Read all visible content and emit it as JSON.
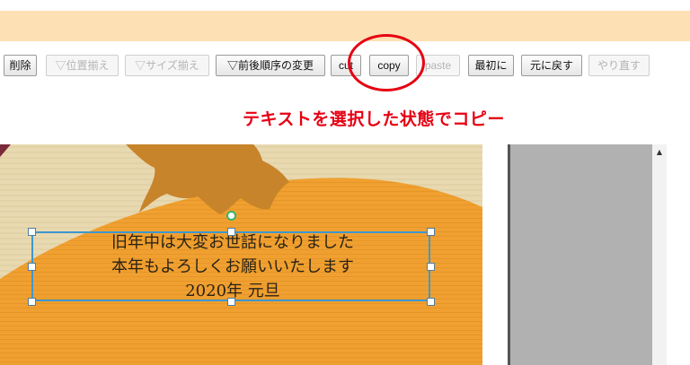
{
  "toolbar": {
    "buttons": [
      {
        "label": "削除",
        "enabled": true
      },
      {
        "label": "▽位置揃え",
        "enabled": false
      },
      {
        "label": "▽サイズ揃え",
        "enabled": false
      },
      {
        "label": "▽前後順序の変更",
        "enabled": true
      },
      {
        "label": "cut",
        "enabled": true
      },
      {
        "label": "copy",
        "enabled": true
      },
      {
        "label": "paste",
        "enabled": false
      },
      {
        "label": "最初に",
        "enabled": true
      },
      {
        "label": "元に戻す",
        "enabled": true
      },
      {
        "label": "やり直す",
        "enabled": false
      }
    ]
  },
  "annotation": {
    "text": "テキストを選択した状態でコピー",
    "color": "#e60012"
  },
  "card": {
    "lines": [
      "旧年中は大変お世話になりました",
      "本年もよろしくお願いいたします",
      "2020年 元旦"
    ]
  },
  "colors": {
    "topbar": "#fde0b3",
    "card_orange": "#f0a030",
    "card_beige": "#e8d9b0",
    "card_brown": "#c8842a",
    "selection": "#3f97cf",
    "side_panel": "#b1b1b1"
  },
  "scrollbar": {
    "up_icon": "triangle-up-icon"
  }
}
